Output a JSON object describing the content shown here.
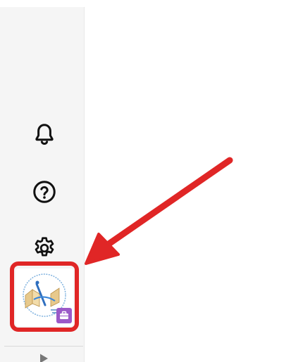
{
  "side_rail": {
    "items": [
      {
        "icon": "bell-icon"
      },
      {
        "icon": "help-circle-icon"
      },
      {
        "icon": "gear-icon"
      }
    ],
    "app_tile": {
      "logo_icon": "school-logo-icon",
      "badge_icon": "briefcase-icon",
      "badge_color": "#9b59c8"
    },
    "expand_icon": "play-triangle-icon"
  },
  "annotation": {
    "color": "#e02626"
  }
}
